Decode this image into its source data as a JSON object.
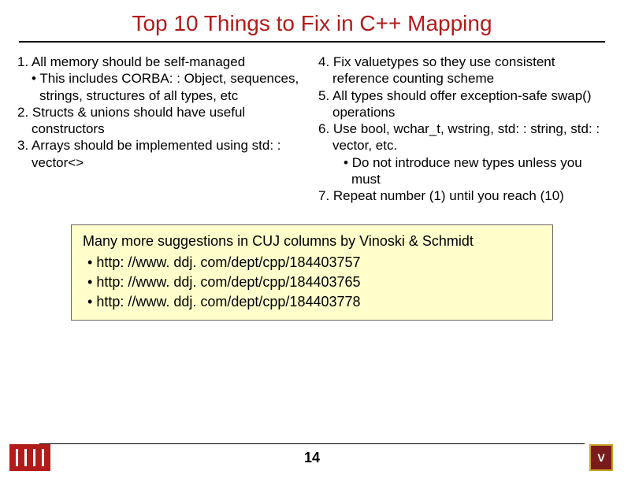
{
  "title": "Top 10 Things to Fix in C++ Mapping",
  "left": {
    "i1": "1. All memory should be self-managed",
    "i1s": "This includes CORBA: : Object, sequences, strings, structures of all types, etc",
    "i2": "2. Structs & unions should have useful constructors",
    "i3": "3. Arrays should be implemented using std: : vector<>"
  },
  "right": {
    "i4": "4. Fix valuetypes so they use consistent reference counting scheme",
    "i5": "5. All types should offer exception-safe swap() operations",
    "i6": "6. Use bool, wchar_t, wstring, std: : string, std: : vector, etc.",
    "i6s": "Do not introduce new types unless you must",
    "i7": "7. Repeat number (1) until you reach (10)"
  },
  "box": {
    "title": "Many more suggestions in CUJ columns by Vinoski & Schmidt",
    "l1": "http: //www. ddj. com/dept/cpp/184403757",
    "l2": "http: //www. ddj. com/dept/cpp/184403765",
    "l3": "http: //www. ddj. com/dept/cpp/184403778"
  },
  "pageNumber": "14",
  "logoRight": "V"
}
